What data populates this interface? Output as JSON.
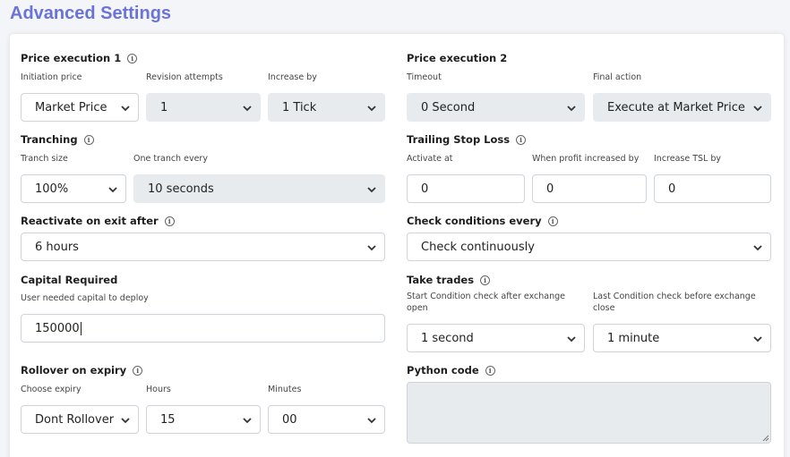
{
  "page_title": "Advanced Settings",
  "price_execution_1": {
    "title": "Price execution 1",
    "initiation_price": {
      "label": "Initiation price",
      "value": "Market Price"
    },
    "revision_attempts": {
      "label": "Revision attempts",
      "value": "1"
    },
    "increase_by": {
      "label": "Increase by",
      "value": "1 Tick"
    }
  },
  "price_execution_2": {
    "title": "Price execution 2",
    "timeout": {
      "label": "Timeout",
      "value": "0 Second"
    },
    "final_action": {
      "label": "Final action",
      "value": "Execute at Market Price"
    }
  },
  "tranching": {
    "title": "Tranching",
    "tranch_size": {
      "label": "Tranch size",
      "value": "100%"
    },
    "one_tranch_every": {
      "label": "One tranch every",
      "value": "10 seconds"
    }
  },
  "trailing_stop_loss": {
    "title": "Trailing Stop Loss",
    "activate_at": {
      "label": "Activate at",
      "value": "0"
    },
    "when_profit_increased_by": {
      "label": "When profit increased by",
      "value": "0"
    },
    "increase_tsl_by": {
      "label": "Increase TSL by",
      "value": "0"
    }
  },
  "reactivate_on_exit_after": {
    "title": "Reactivate on exit after",
    "value": "6 hours"
  },
  "check_conditions_every": {
    "title": "Check conditions every",
    "value": "Check continuously"
  },
  "capital_required": {
    "title": "Capital Required",
    "label": "User needed capital to deploy",
    "value": "150000"
  },
  "take_trades": {
    "title": "Take trades",
    "start_condition": {
      "label": "Start Condition check after exchange open",
      "value": "1 second"
    },
    "last_condition": {
      "label": "Last Condition check before exchange close",
      "value": "1 minute"
    }
  },
  "rollover_on_expiry": {
    "title": "Rollover on expiry",
    "choose_expiry": {
      "label": "Choose expiry",
      "value": "Dont Rollover"
    },
    "hours": {
      "label": "Hours",
      "value": "15"
    },
    "minutes": {
      "label": "Minutes",
      "value": "00"
    }
  },
  "python_code": {
    "title": "Python code",
    "value": ""
  },
  "colors": {
    "accent": "#6a73d8",
    "disabled_bg": "#e8ebee",
    "border": "#cfd3da"
  },
  "icons": {
    "info": "info-circle-icon",
    "dropdown": "chevron-down-icon",
    "resize": "resize-handle-icon"
  }
}
